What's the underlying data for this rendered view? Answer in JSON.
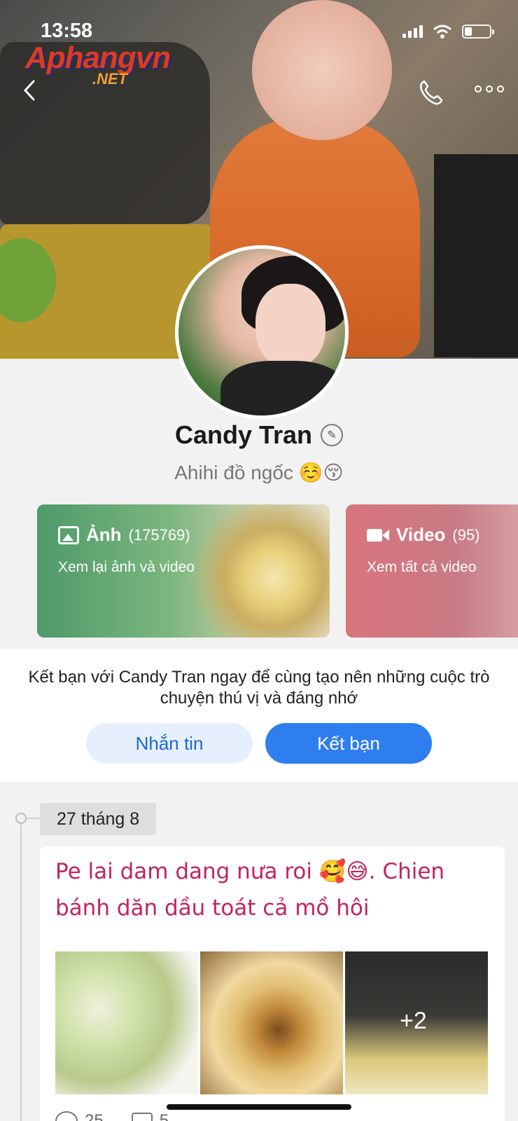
{
  "status": {
    "time": "13:58"
  },
  "watermark": {
    "main": "Aphangvn",
    "sub": ".NET"
  },
  "profile": {
    "name": "Candy Tran",
    "bio": "Ahihi đồ ngốc ☺️😚"
  },
  "media": {
    "photos": {
      "label": "Ảnh",
      "count": "(175769)",
      "subtitle": "Xem lại ảnh và video"
    },
    "videos": {
      "label": "Video",
      "count": "(95)",
      "subtitle": "Xem tất cả video"
    }
  },
  "friend_panel": {
    "text": "Kết bạn với Candy Tran ngay để cùng tạo nên những cuộc trò chuyện thú vị và đáng nhớ",
    "message_button": "Nhắn tin",
    "add_friend_button": "Kết bạn"
  },
  "timeline": {
    "date": "27 tháng 8",
    "post": {
      "text": "Pe lai dam dang nưa roi 🥰😅. Chien bánh dăn dầu toát cả mồ hôi",
      "more_photos": "+2",
      "likes": "25",
      "comments": "5"
    }
  },
  "icons": [
    "back-icon",
    "phone-icon",
    "more-icon",
    "edit-icon",
    "photo-icon",
    "video-icon",
    "heart-icon",
    "comment-icon"
  ]
}
